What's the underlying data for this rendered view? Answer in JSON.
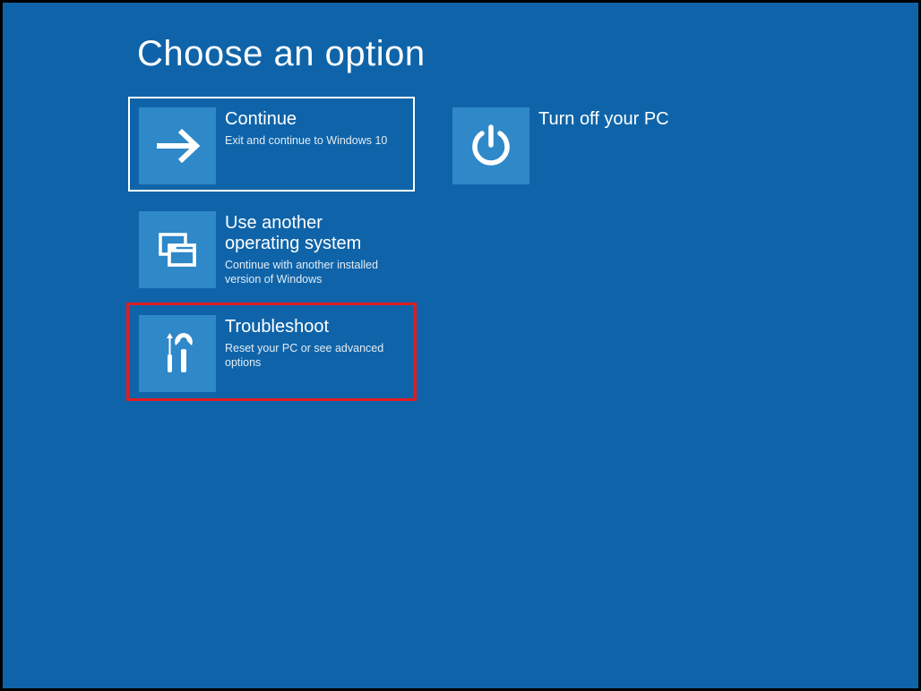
{
  "title": "Choose an option",
  "tiles": {
    "continue": {
      "heading": "Continue",
      "sub": "Exit and continue to Windows 10"
    },
    "use_other": {
      "heading": "Use another operating system",
      "sub": "Continue with another installed version of Windows"
    },
    "trouble": {
      "heading": "Troubleshoot",
      "sub": "Reset your PC or see advanced options"
    },
    "turn_off": {
      "heading": "Turn off your PC",
      "sub": ""
    }
  }
}
